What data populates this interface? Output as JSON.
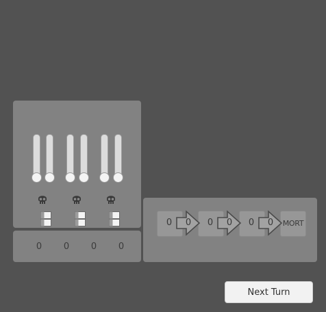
{
  "units": [
    {
      "sliders": [
        0.0,
        0.0
      ],
      "icon": "skull-icon",
      "toggle": [
        "white",
        "white"
      ]
    },
    {
      "sliders": [
        0.0,
        0.0
      ],
      "icon": "skull-icon",
      "toggle": [
        "white",
        "white"
      ]
    },
    {
      "sliders": [
        0.0,
        0.0
      ],
      "icon": "skull-icon",
      "toggle": [
        "white",
        "white"
      ]
    }
  ],
  "counters": [
    "0",
    "0",
    "0",
    "0"
  ],
  "pipeline": {
    "stages": [
      "0",
      "0",
      "0",
      "0",
      "0",
      "0"
    ],
    "end_label": "MORT"
  },
  "next_turn_label": "Next Turn",
  "colors": {
    "background": "#525252",
    "panel": "#828282",
    "stage": "#979797",
    "button": "#f2f2f2"
  }
}
